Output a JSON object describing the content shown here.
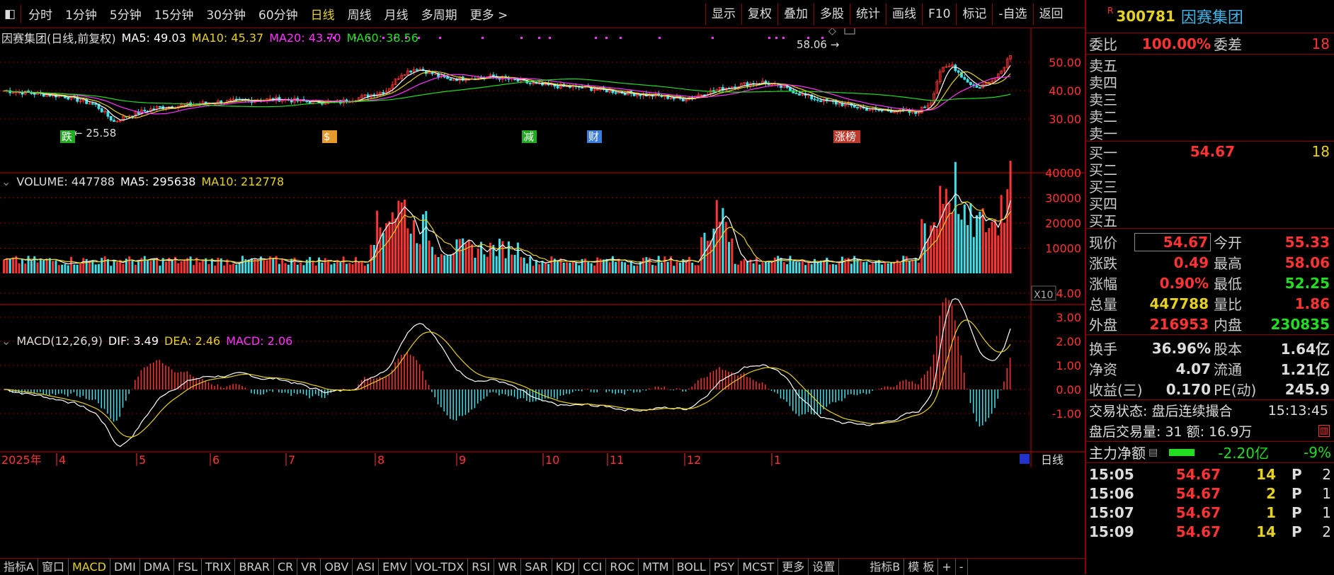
{
  "colors": {
    "up": "#ff3333",
    "down": "#3fe0e8",
    "ma5": "#ffffff",
    "ma10": "#e6d21e",
    "ma20": "#ff33ff",
    "ma60": "#22dd22",
    "grid": "#8b0000"
  },
  "period_tabs": [
    {
      "label": "分时"
    },
    {
      "label": "1分钟"
    },
    {
      "label": "5分钟"
    },
    {
      "label": "15分钟"
    },
    {
      "label": "30分钟"
    },
    {
      "label": "60分钟"
    },
    {
      "label": "日线",
      "active": true
    },
    {
      "label": "周线"
    },
    {
      "label": "月线"
    },
    {
      "label": "多周期"
    },
    {
      "label": "更多 >"
    }
  ],
  "toolbar": [
    "显示",
    "复权",
    "叠加",
    "多股",
    "统计",
    "画线",
    "F10",
    "标记",
    "-自选",
    "返回"
  ],
  "kline": {
    "title": "因赛集团(日线,前复权)",
    "ma5": "MA5: 49.03",
    "ma10": "MA10: 45.37",
    "ma20": "MA20: 43.70",
    "ma60": "MA60: 38.56",
    "y_ticks": [
      "50.00",
      "40.00",
      "30.00"
    ],
    "high_mark": "58.06",
    "low_mark": "25.58",
    "events": [
      {
        "label": "跌",
        "color": "#22aa22"
      },
      {
        "label": "$",
        "color": "#e69a2e"
      },
      {
        "label": "减",
        "color": "#22aa22"
      },
      {
        "label": "财",
        "color": "#3b7bd9"
      },
      {
        "label": "涨榜",
        "color": "#c0392b"
      }
    ]
  },
  "volume": {
    "title": "VOLUME: 447788",
    "ma5": "MA5: 295638",
    "ma10": "MA10: 212778",
    "y_ticks": [
      "40000",
      "30000",
      "20000",
      "10000"
    ],
    "unit": "X10"
  },
  "macd": {
    "title": "MACD(12,26,9)",
    "dif": "DIF: 3.49",
    "dea": "DEA: 2.46",
    "macd": "MACD: 2.06",
    "y_ticks": [
      "4.00",
      "3.00",
      "2.00",
      "1.00",
      "0.00",
      "-1.00"
    ]
  },
  "x_axis": {
    "year": "2025年",
    "months": [
      "4",
      "5",
      "6",
      "7",
      "8",
      "9",
      "10",
      "11",
      "12",
      "1"
    ],
    "period": "日线"
  },
  "indicator_tabs": [
    {
      "label": "指标A"
    },
    {
      "label": "窗口"
    },
    {
      "label": "MACD",
      "active": true
    },
    {
      "label": "DMI"
    },
    {
      "label": "DMA"
    },
    {
      "label": "FSL"
    },
    {
      "label": "TRIX"
    },
    {
      "label": "BRAR"
    },
    {
      "label": "CR"
    },
    {
      "label": "VR"
    },
    {
      "label": "OBV"
    },
    {
      "label": "ASI"
    },
    {
      "label": "EMV"
    },
    {
      "label": "VOL-TDX"
    },
    {
      "label": "RSI"
    },
    {
      "label": "WR"
    },
    {
      "label": "SAR"
    },
    {
      "label": "KDJ"
    },
    {
      "label": "CCI"
    },
    {
      "label": "ROC"
    },
    {
      "label": "MTM"
    },
    {
      "label": "BOLL"
    },
    {
      "label": "PSY"
    },
    {
      "label": "MCST"
    },
    {
      "label": "更多"
    },
    {
      "label": "设置"
    },
    {
      "label": "指标B"
    },
    {
      "label": "模 板"
    },
    {
      "label": "+"
    },
    {
      "label": "-"
    }
  ],
  "quote": {
    "code": "300781",
    "name": "因赛集团",
    "badge": "R",
    "weibi_label": "委比",
    "weibi": "100.00%",
    "weicha_label": "委差",
    "weicha": "18",
    "sells": [
      {
        "label": "卖五",
        "price": "",
        "vol": ""
      },
      {
        "label": "卖四",
        "price": "",
        "vol": ""
      },
      {
        "label": "卖三",
        "price": "",
        "vol": ""
      },
      {
        "label": "卖二",
        "price": "",
        "vol": ""
      },
      {
        "label": "卖一",
        "price": "",
        "vol": ""
      }
    ],
    "buys": [
      {
        "label": "买一",
        "price": "54.67",
        "vol": "18"
      },
      {
        "label": "买二",
        "price": "",
        "vol": ""
      },
      {
        "label": "买三",
        "price": "",
        "vol": ""
      },
      {
        "label": "买四",
        "price": "",
        "vol": ""
      },
      {
        "label": "买五",
        "price": "",
        "vol": ""
      }
    ],
    "stats": [
      {
        "l1": "现价",
        "v1": "54.67",
        "c1": "red",
        "l2": "今开",
        "v2": "55.33",
        "c2": "red"
      },
      {
        "l1": "涨跌",
        "v1": "0.49",
        "c1": "red",
        "l2": "最高",
        "v2": "58.06",
        "c2": "red"
      },
      {
        "l1": "涨幅",
        "v1": "0.90%",
        "c1": "red",
        "l2": "最低",
        "v2": "52.25",
        "c2": "green"
      },
      {
        "l1": "总量",
        "v1": "447788",
        "c1": "yellow",
        "l2": "量比",
        "v2": "1.86",
        "c2": "red"
      },
      {
        "l1": "外盘",
        "v1": "216953",
        "c1": "red",
        "l2": "内盘",
        "v2": "230835",
        "c2": "green"
      }
    ],
    "stats2": [
      {
        "l1": "换手",
        "v1": "36.96%",
        "l2": "股本",
        "v2": "1.64亿"
      },
      {
        "l1": "净资",
        "v1": "4.07",
        "l2": "流通",
        "v2": "1.21亿"
      },
      {
        "l1": "收益(三)",
        "v1": "0.170",
        "l2": "PE(动)",
        "v2": "245.9"
      }
    ],
    "trade_status": "交易状态: 盘后连续撮合",
    "trade_time": "15:13:45",
    "after_hours": "盘后交易量: 31  额: 16.9万",
    "main_flow_label": "主力净额",
    "main_flow": "-2.20亿",
    "main_flow_pct": "-9%",
    "ticks": [
      {
        "time": "15:05",
        "price": "54.67",
        "vol": "14",
        "flag": "P",
        "n": "2"
      },
      {
        "time": "15:06",
        "price": "54.67",
        "vol": "2",
        "flag": "P",
        "n": "1"
      },
      {
        "time": "15:07",
        "price": "54.67",
        "vol": "1",
        "flag": "P",
        "n": "1"
      },
      {
        "time": "15:09",
        "price": "54.67",
        "vol": "14",
        "flag": "P",
        "n": "2"
      }
    ]
  }
}
